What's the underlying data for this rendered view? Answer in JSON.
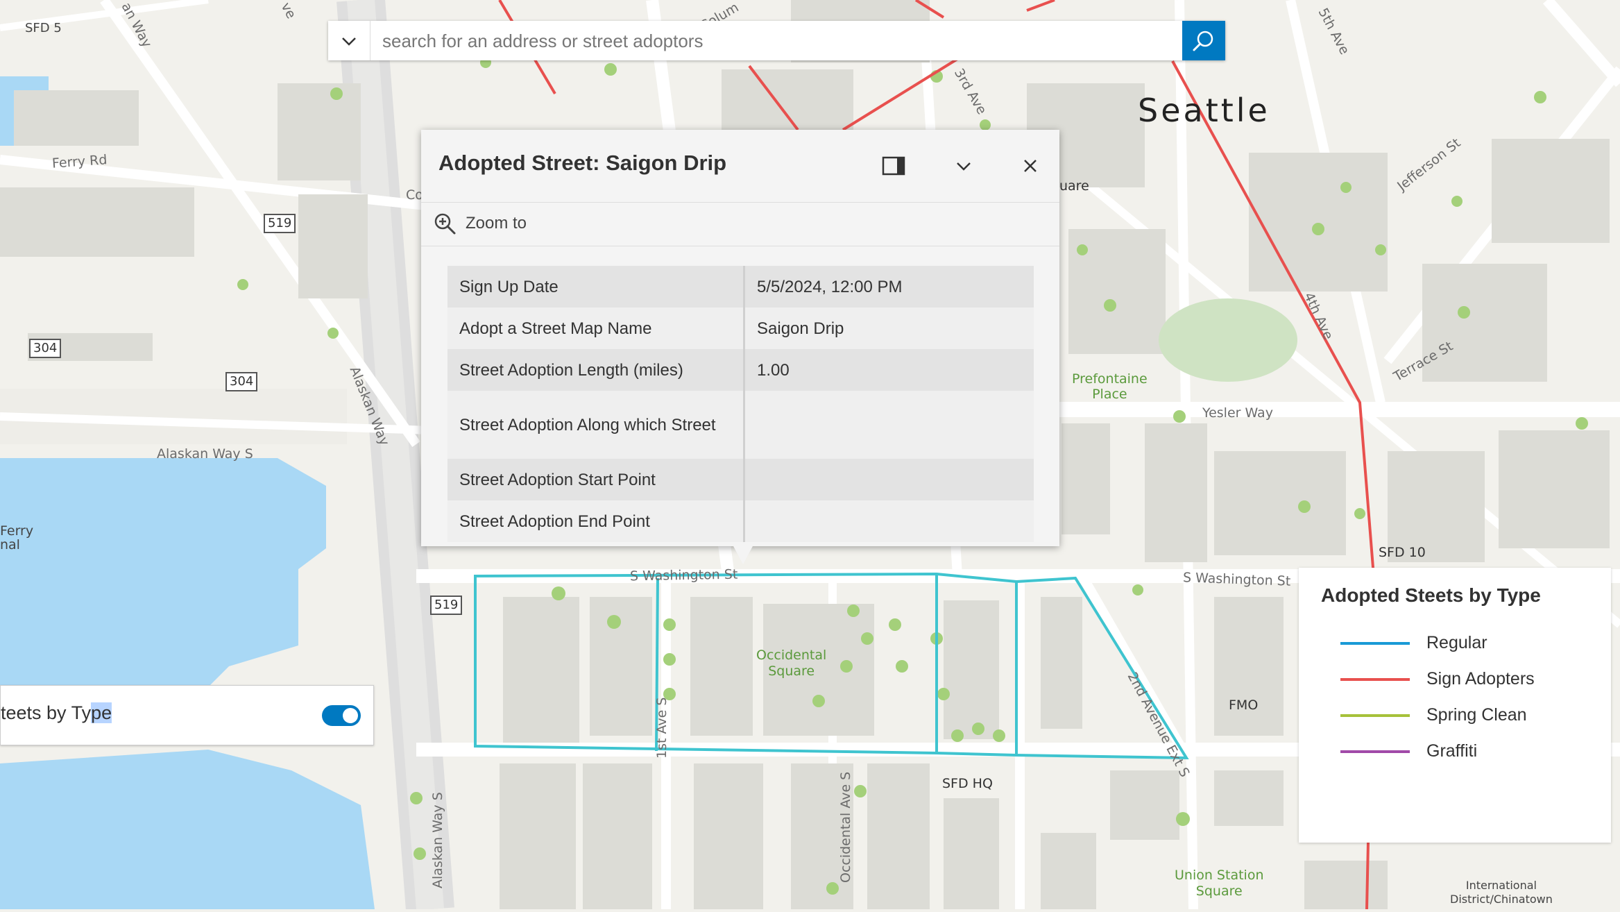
{
  "search": {
    "placeholder": "search for an address or street adoptors"
  },
  "map": {
    "city_label": "Seattle",
    "street_labels": {
      "ferry_rd": "Ferry Rd",
      "alaskan_way_s": "Alaskan Way S",
      "alaskan_way_vert": "Alaskan Way",
      "alaskan_way_s_vert": "Alaskan Way S",
      "alaskan_way_top": "an Way",
      "yesler_way": "Yesler Way",
      "s_washington_st_right": "S Washington St",
      "s_washington_st_mid": "S Washington St",
      "jefferson_st": "Jefferson St",
      "terrace_st": "Terrace St",
      "third_ave": "3rd Ave",
      "fourth_ave": "4th Ave",
      "fifth_ave": "5th Ave",
      "first_ave_s": "1st Ave S",
      "occidental_ave_s": "Occidental Ave S",
      "second_ave_ext_s": "2nd Avenue Ext S",
      "columbia_partial": "Colum",
      "c_partial": "Co",
      "ve_partial": "ve",
      "square_partial": "uare"
    },
    "place_labels": {
      "sfd5": "SFD 5",
      "sfd10": "SFD 10",
      "sfd_hq": "SFD HQ",
      "fmo": "FMO",
      "ferry_terminal_1": "Ferry",
      "ferry_terminal_2": "nal",
      "prefontaine_1": "Prefontaine",
      "prefontaine_2": "Place",
      "occidental_1": "Occidental",
      "occidental_2": "Square",
      "union_station_1": "Union Station",
      "union_station_2": "Square",
      "intl_district_1": "International",
      "intl_district_2": "District/Chinatown"
    },
    "route_shields": [
      "519",
      "304",
      "304",
      "519"
    ]
  },
  "popup": {
    "title": "Adopted Street: Saigon Drip",
    "zoom_to_label": "Zoom to",
    "attributes": [
      {
        "key": "Sign Up Date",
        "value": "5/5/2024, 12:00 PM"
      },
      {
        "key": "Adopt a Street Map Name",
        "value": "Saigon Drip"
      },
      {
        "key": "Street Adoption Length (miles)",
        "value": "1.00"
      },
      {
        "key": "Street Adoption Along which Street",
        "value": ""
      },
      {
        "key": "Street Adoption Start Point",
        "value": ""
      },
      {
        "key": "Street Adoption End Point",
        "value": ""
      }
    ]
  },
  "layer_toggle": {
    "label_prefix": "teets by Ty",
    "label_selected": "pe",
    "enabled": true
  },
  "legend": {
    "title": "Adopted Steets by Type",
    "items": [
      {
        "label": "Regular",
        "color": "#1a9ad6"
      },
      {
        "label": "Sign Adopters",
        "color": "#e8504e"
      },
      {
        "label": "Spring Clean",
        "color": "#a6c13a"
      },
      {
        "label": "Graffiti",
        "color": "#a14aa8"
      }
    ]
  },
  "colors": {
    "water": "#a9d8f5",
    "land": "#f2f1ec",
    "building": "#dcdcd6",
    "road": "#ffffff",
    "highlight": "#3fc4cf",
    "accent": "#0079c1"
  }
}
